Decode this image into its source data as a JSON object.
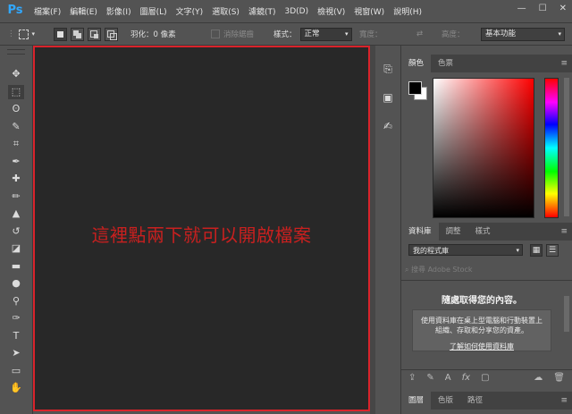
{
  "app": {
    "logo": "Ps"
  },
  "menu": [
    "檔案(F)",
    "編輯(E)",
    "影像(I)",
    "圖層(L)",
    "文字(Y)",
    "選取(S)",
    "濾鏡(T)",
    "3D(D)",
    "檢視(V)",
    "視窗(W)",
    "說明(H)"
  ],
  "window_controls": {
    "minimize": "—",
    "maximize": "☐",
    "close": "✕"
  },
  "options_bar": {
    "feather_label": "羽化：",
    "feather_value": "0 像素",
    "antialias_label": "消除鋸齒",
    "style_label": "樣式：",
    "style_value": "正常",
    "width_label": "寬度：",
    "height_label": "高度：",
    "workspace": "基本功能"
  },
  "tools": [
    {
      "name": "move-tool",
      "glyph": "✥"
    },
    {
      "name": "marquee-tool",
      "glyph": "⬚"
    },
    {
      "name": "lasso-tool",
      "glyph": "ʘ"
    },
    {
      "name": "quick-select-tool",
      "glyph": "✎"
    },
    {
      "name": "crop-tool",
      "glyph": "⌗"
    },
    {
      "name": "eyedropper-tool",
      "glyph": "✒"
    },
    {
      "name": "healing-brush-tool",
      "glyph": "✚"
    },
    {
      "name": "brush-tool",
      "glyph": "✏"
    },
    {
      "name": "stamp-tool",
      "glyph": "▲"
    },
    {
      "name": "history-brush-tool",
      "glyph": "↺"
    },
    {
      "name": "eraser-tool",
      "glyph": "◪"
    },
    {
      "name": "gradient-tool",
      "glyph": "▬"
    },
    {
      "name": "blur-tool",
      "glyph": "●"
    },
    {
      "name": "dodge-tool",
      "glyph": "⚲"
    },
    {
      "name": "pen-tool",
      "glyph": "✑"
    },
    {
      "name": "type-tool",
      "glyph": "T"
    },
    {
      "name": "path-select-tool",
      "glyph": "➤"
    },
    {
      "name": "shape-tool",
      "glyph": "▭"
    },
    {
      "name": "hand-tool",
      "glyph": "✋"
    }
  ],
  "canvas": {
    "instruction": "這裡點兩下就可以開啟檔案"
  },
  "color_panel": {
    "tabs": [
      "顏色",
      "色票"
    ]
  },
  "library_panel": {
    "tabs": [
      "資料庫",
      "調整",
      "樣式"
    ],
    "library_select": "我的程式庫",
    "search_placeholder": "搜尋 Adobe Stock",
    "heading": "隨處取得您的內容。",
    "description": "使用資料庫在桌上型電腦和行動裝置上組織、存取和分享您的資產。",
    "link": "了解如何使用資料庫"
  },
  "layers_panel": {
    "tabs": [
      "圖層",
      "色版",
      "路徑"
    ]
  },
  "colors": {
    "accent_red": "#d9232b",
    "ps_blue": "#31a8ff",
    "canvas_bg": "#282828"
  }
}
